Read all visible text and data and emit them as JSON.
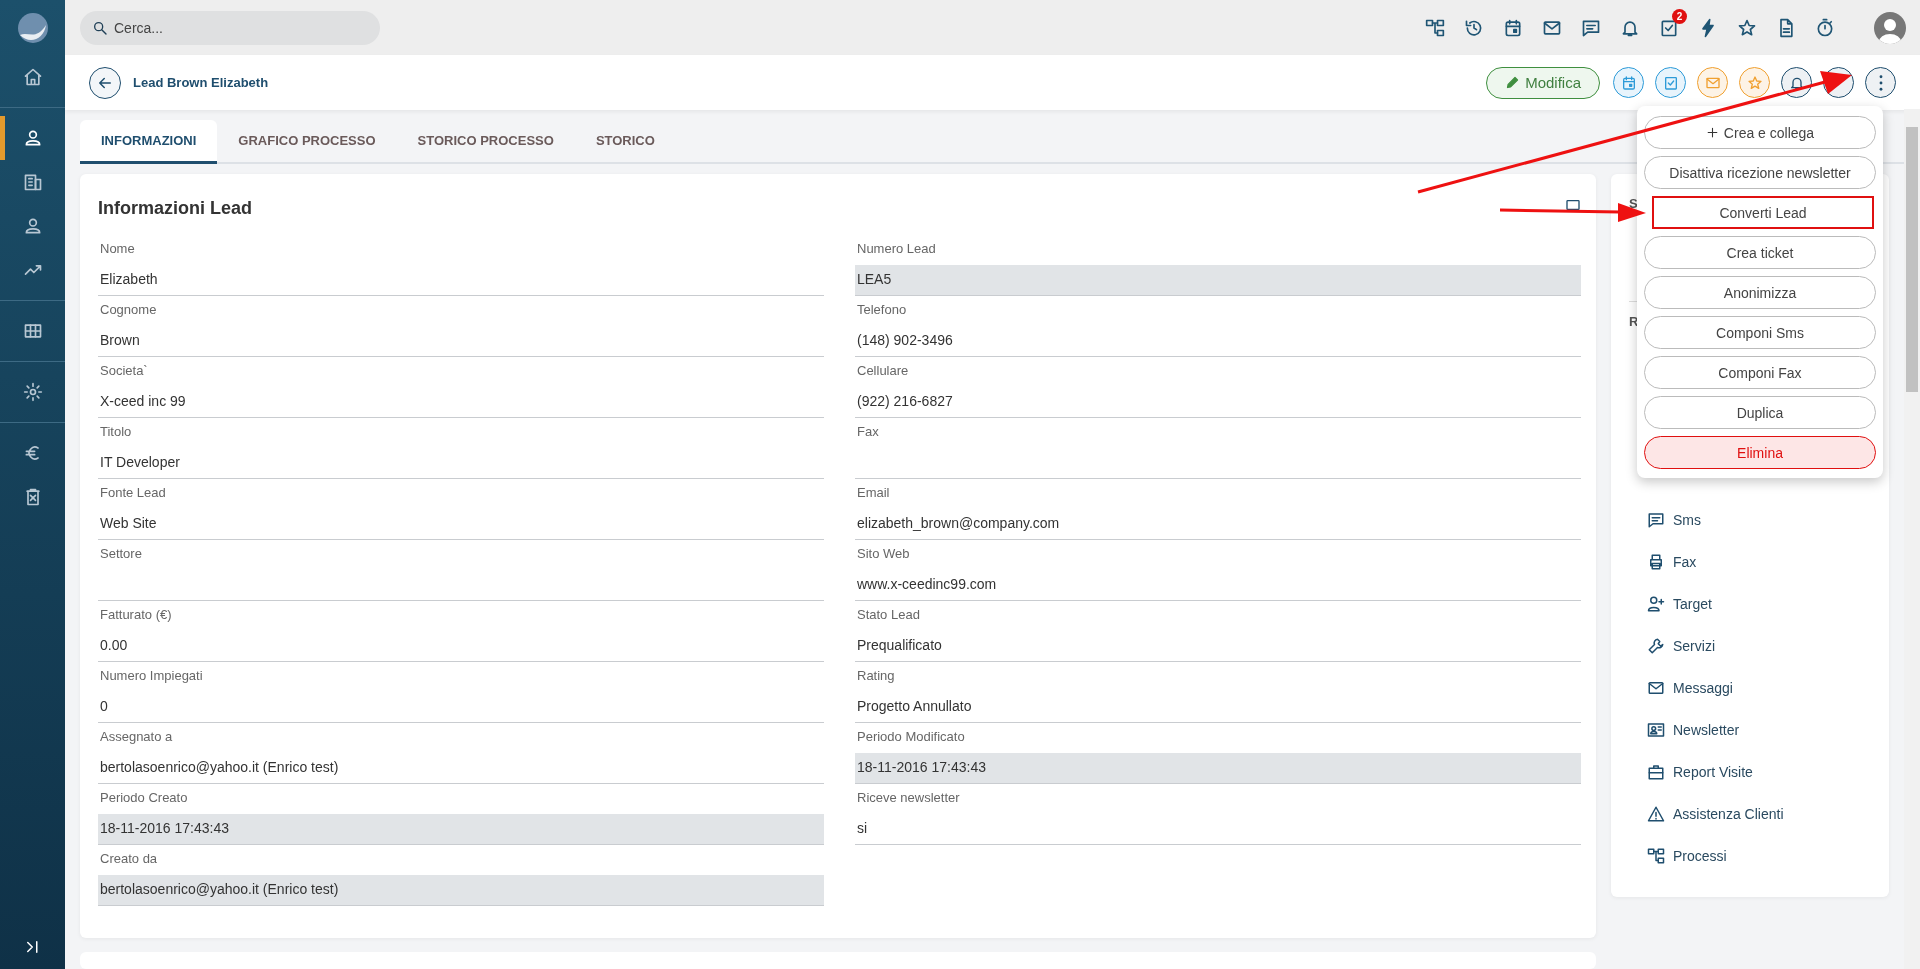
{
  "sidebar": {
    "items": [
      {
        "selected": false
      },
      {
        "selected": true
      },
      {
        "selected": false
      },
      {
        "selected": false
      },
      {
        "selected": false
      },
      {
        "selected": false
      },
      {
        "selected": false
      },
      {
        "selected": false
      },
      {
        "selected": false
      }
    ]
  },
  "top_bar": {
    "search": {
      "placeholder": "Cerca..."
    },
    "task_badge": "2"
  },
  "header": {
    "title": "Lead Brown Elizabeth",
    "edit_label": "Modifica"
  },
  "tabs": [
    {
      "label": "INFORMAZIONI",
      "selected": true
    },
    {
      "label": "GRAFICO PROCESSO",
      "selected": false
    },
    {
      "label": "STORICO PROCESSO",
      "selected": false
    },
    {
      "label": "STORICO",
      "selected": false
    }
  ],
  "card": {
    "title": "Informazioni Lead",
    "left_fields": [
      {
        "label": "Nome",
        "value": "Elizabeth",
        "readonly": false
      },
      {
        "label": "Cognome",
        "value": "Brown",
        "readonly": false
      },
      {
        "label": "Societa`",
        "value": "X-ceed inc 99",
        "readonly": false
      },
      {
        "label": "Titolo",
        "value": "IT Developer",
        "readonly": false
      },
      {
        "label": "Fonte Lead",
        "value": "Web Site",
        "readonly": false
      },
      {
        "label": "Settore",
        "readonly": false
      },
      {
        "label": "Fatturato (€)",
        "value": "0.00",
        "readonly": false
      },
      {
        "label": "Numero Impiegati",
        "value": "0",
        "readonly": false
      },
      {
        "label": "Assegnato a",
        "value": "bertolasoenrico@yahoo.it (Enrico test)",
        "readonly": false
      },
      {
        "label": "Periodo Creato",
        "value": "18-11-2016 17:43:43",
        "readonly": true
      },
      {
        "label": "Creato da",
        "value": "bertolasoenrico@yahoo.it (Enrico test)",
        "readonly": true
      }
    ],
    "right_fields": [
      {
        "label": "Numero Lead",
        "value": "LEA5",
        "readonly": true
      },
      {
        "label": "Telefono",
        "value": "(148) 902-3496",
        "readonly": false
      },
      {
        "label": "Cellulare",
        "value": "(922) 216-6827",
        "readonly": false
      },
      {
        "label": "Fax",
        "readonly": false
      },
      {
        "label": "Email",
        "value": "elizabeth_brown@company.com",
        "readonly": false
      },
      {
        "label": "Sito Web",
        "value": "www.x-ceedinc99.com",
        "readonly": false
      },
      {
        "label": "Stato Lead",
        "value": "Prequalificato",
        "readonly": false
      },
      {
        "label": "Rating",
        "value": "Progetto Annullato",
        "readonly": false
      },
      {
        "label": "Periodo Modificato",
        "value": "18-11-2016 17:43:43",
        "readonly": true
      },
      {
        "label": "Riceve newsletter",
        "value": "si",
        "readonly": false
      }
    ]
  },
  "side_panel": {
    "headings": [
      "S",
      "R"
    ],
    "items": [
      {
        "label": "Sms"
      },
      {
        "label": "Fax"
      },
      {
        "label": "Target"
      },
      {
        "label": "Servizi"
      },
      {
        "label": "Messaggi"
      },
      {
        "label": "Newsletter"
      },
      {
        "label": "Report Visite"
      },
      {
        "label": "Assistenza Clienti"
      },
      {
        "label": "Processi"
      }
    ]
  },
  "menu": [
    {
      "label": "Crea e collega",
      "kind": "add",
      "highlighted": false
    },
    {
      "label": "Disattiva ricezione newsletter",
      "kind": "plain",
      "highlighted": false
    },
    {
      "label": "Converti Lead",
      "kind": "plain",
      "highlighted": true
    },
    {
      "label": "Crea ticket",
      "kind": "plain",
      "highlighted": false
    },
    {
      "label": "Anonimizza",
      "kind": "plain",
      "highlighted": false
    },
    {
      "label": "Componi Sms",
      "kind": "plain",
      "highlighted": false
    },
    {
      "label": "Componi Fax",
      "kind": "plain",
      "highlighted": false
    },
    {
      "label": "Duplica",
      "kind": "plain",
      "highlighted": false
    },
    {
      "label": "Elimina",
      "kind": "danger",
      "highlighted": false
    }
  ]
}
